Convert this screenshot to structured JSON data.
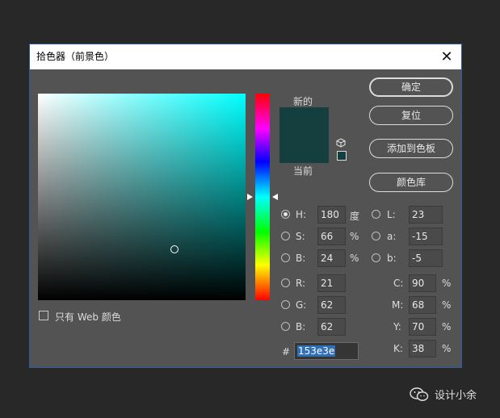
{
  "window": {
    "title": "拾色器（前景色）",
    "close_glyph": "✕"
  },
  "picker": {
    "selected_color": "#153e3e"
  },
  "preview": {
    "new_label": "新的",
    "current_label": "当前"
  },
  "buttons": {
    "ok": "确定",
    "reset": "复位",
    "add_to_swatches": "添加到色板",
    "color_libraries": "颜色库"
  },
  "hsb": [
    {
      "label": "H:",
      "value": "180",
      "unit": "度",
      "selected": true
    },
    {
      "label": "S:",
      "value": "66",
      "unit": "%",
      "selected": false
    },
    {
      "label": "B:",
      "value": "24",
      "unit": "%",
      "selected": false
    }
  ],
  "rgb": [
    {
      "label": "R:",
      "value": "21"
    },
    {
      "label": "G:",
      "value": "62"
    },
    {
      "label": "B:",
      "value": "62"
    }
  ],
  "lab": [
    {
      "label": "L:",
      "value": "23"
    },
    {
      "label": "a:",
      "value": "-15"
    },
    {
      "label": "b:",
      "value": "-5"
    }
  ],
  "cmyk": [
    {
      "label": "C:",
      "value": "90",
      "unit": "%"
    },
    {
      "label": "M:",
      "value": "68",
      "unit": "%"
    },
    {
      "label": "Y:",
      "value": "70",
      "unit": "%"
    },
    {
      "label": "K:",
      "value": "38",
      "unit": "%"
    }
  ],
  "hex": {
    "label": "#",
    "value": "153e3e"
  },
  "web_only": {
    "label": "只有 Web 颜色",
    "checked": false
  },
  "watermark": {
    "text": "设计小余"
  }
}
